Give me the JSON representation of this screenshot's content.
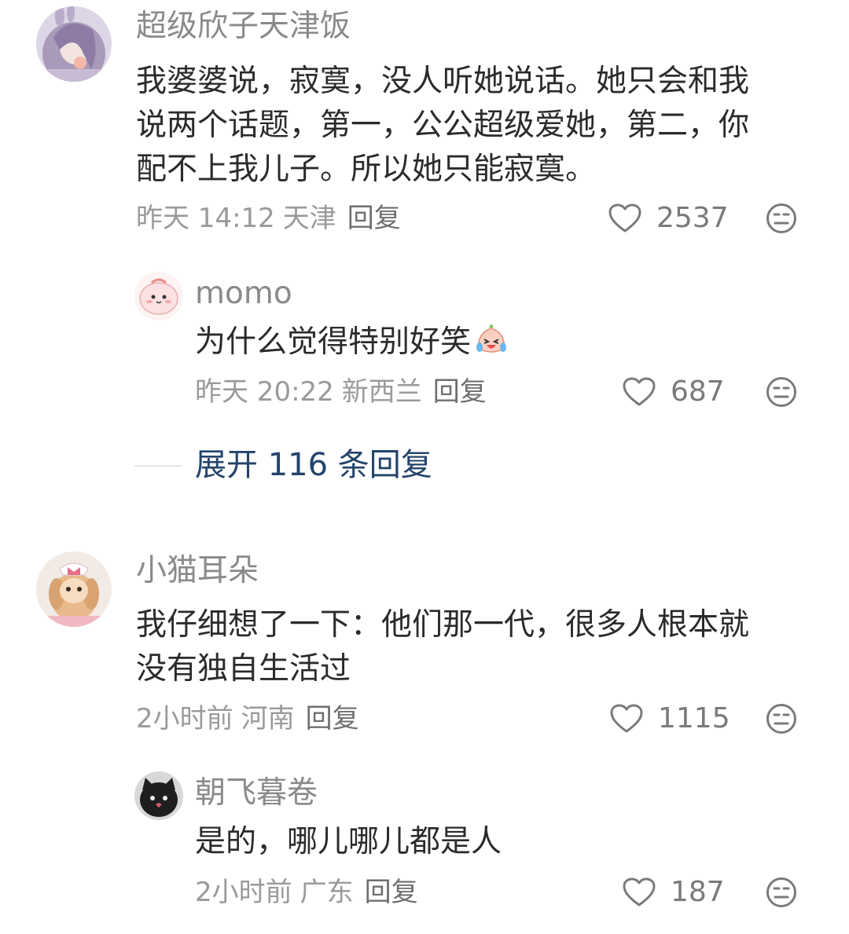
{
  "comments": [
    {
      "username": "超级欣子天津饭",
      "content_lines": [
        "我婆婆说，寂寞，没人听她说话。她只会和我",
        "说两个话题，第一，公公超级爱她，第二，你",
        "配不上我儿子。所以她只能寂寞。"
      ],
      "time": "昨天 14:12",
      "location": "天津",
      "reply_label": "回复",
      "likes": "2537",
      "avatar_icon": "avatar-purple-hair-girl"
    },
    {
      "username": "momo",
      "content_lines": [
        "为什么觉得特别好笑"
      ],
      "content_emoji": "laughing-crying-emoji",
      "time": "昨天 20:22",
      "location": "新西兰",
      "reply_label": "回复",
      "likes": "687",
      "avatar_icon": "avatar-pink-blob"
    },
    {
      "username": "小猫耳朵",
      "content_lines": [
        "我仔细想了一下：他们那一代，很多人根本就",
        "没有独自生活过"
      ],
      "time": "2小时前",
      "location": "河南",
      "reply_label": "回复",
      "likes": "1115",
      "avatar_icon": "avatar-plush-toy"
    },
    {
      "username": "朝飞暮卷",
      "content_lines": [
        "是的，哪儿哪儿都是人"
      ],
      "time": "2小时前",
      "location": "广东",
      "reply_label": "回复",
      "likes": "187",
      "avatar_icon": "avatar-black-cat"
    }
  ],
  "expand_replies": "展开 116 条回复",
  "colors": {
    "username": "#8a8a8a",
    "content": "#2b2b2b",
    "meta": "#9a9a9a",
    "expand": "#23446b"
  }
}
